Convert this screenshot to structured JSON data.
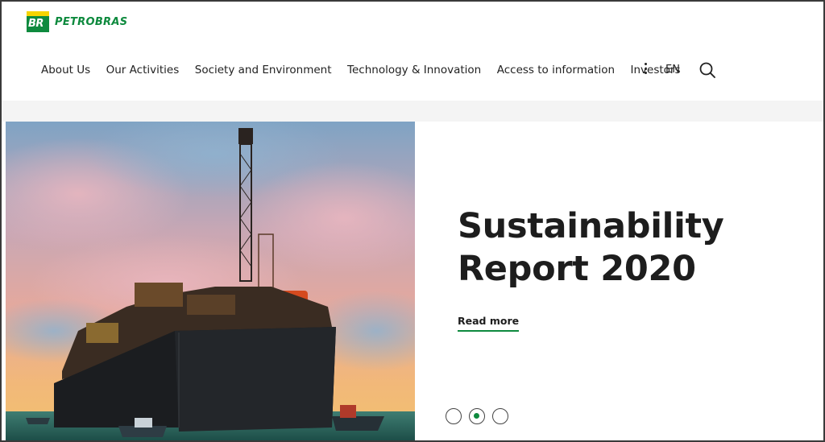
{
  "brand": {
    "logo_mark_text": "BR",
    "logo_word": "PETROBRAS",
    "green": "#0e8a3e",
    "yellow": "#f5d400"
  },
  "nav": {
    "items": [
      {
        "label": "About Us"
      },
      {
        "label": "Our Activities"
      },
      {
        "label": "Society and Environment"
      },
      {
        "label": "Technology & Innovation"
      },
      {
        "label": "Access to information"
      },
      {
        "label": "Investors"
      }
    ],
    "more_icon": "vertical-ellipsis-icon",
    "language": "EN",
    "search_icon": "search-icon"
  },
  "hero": {
    "image": "offshore-oil-platform-at-sunset",
    "title_line1": "Sustainability",
    "title_line2": "Report 2020",
    "cta_label": "Read more"
  },
  "carousel": {
    "slides": 3,
    "active_index": 1
  }
}
